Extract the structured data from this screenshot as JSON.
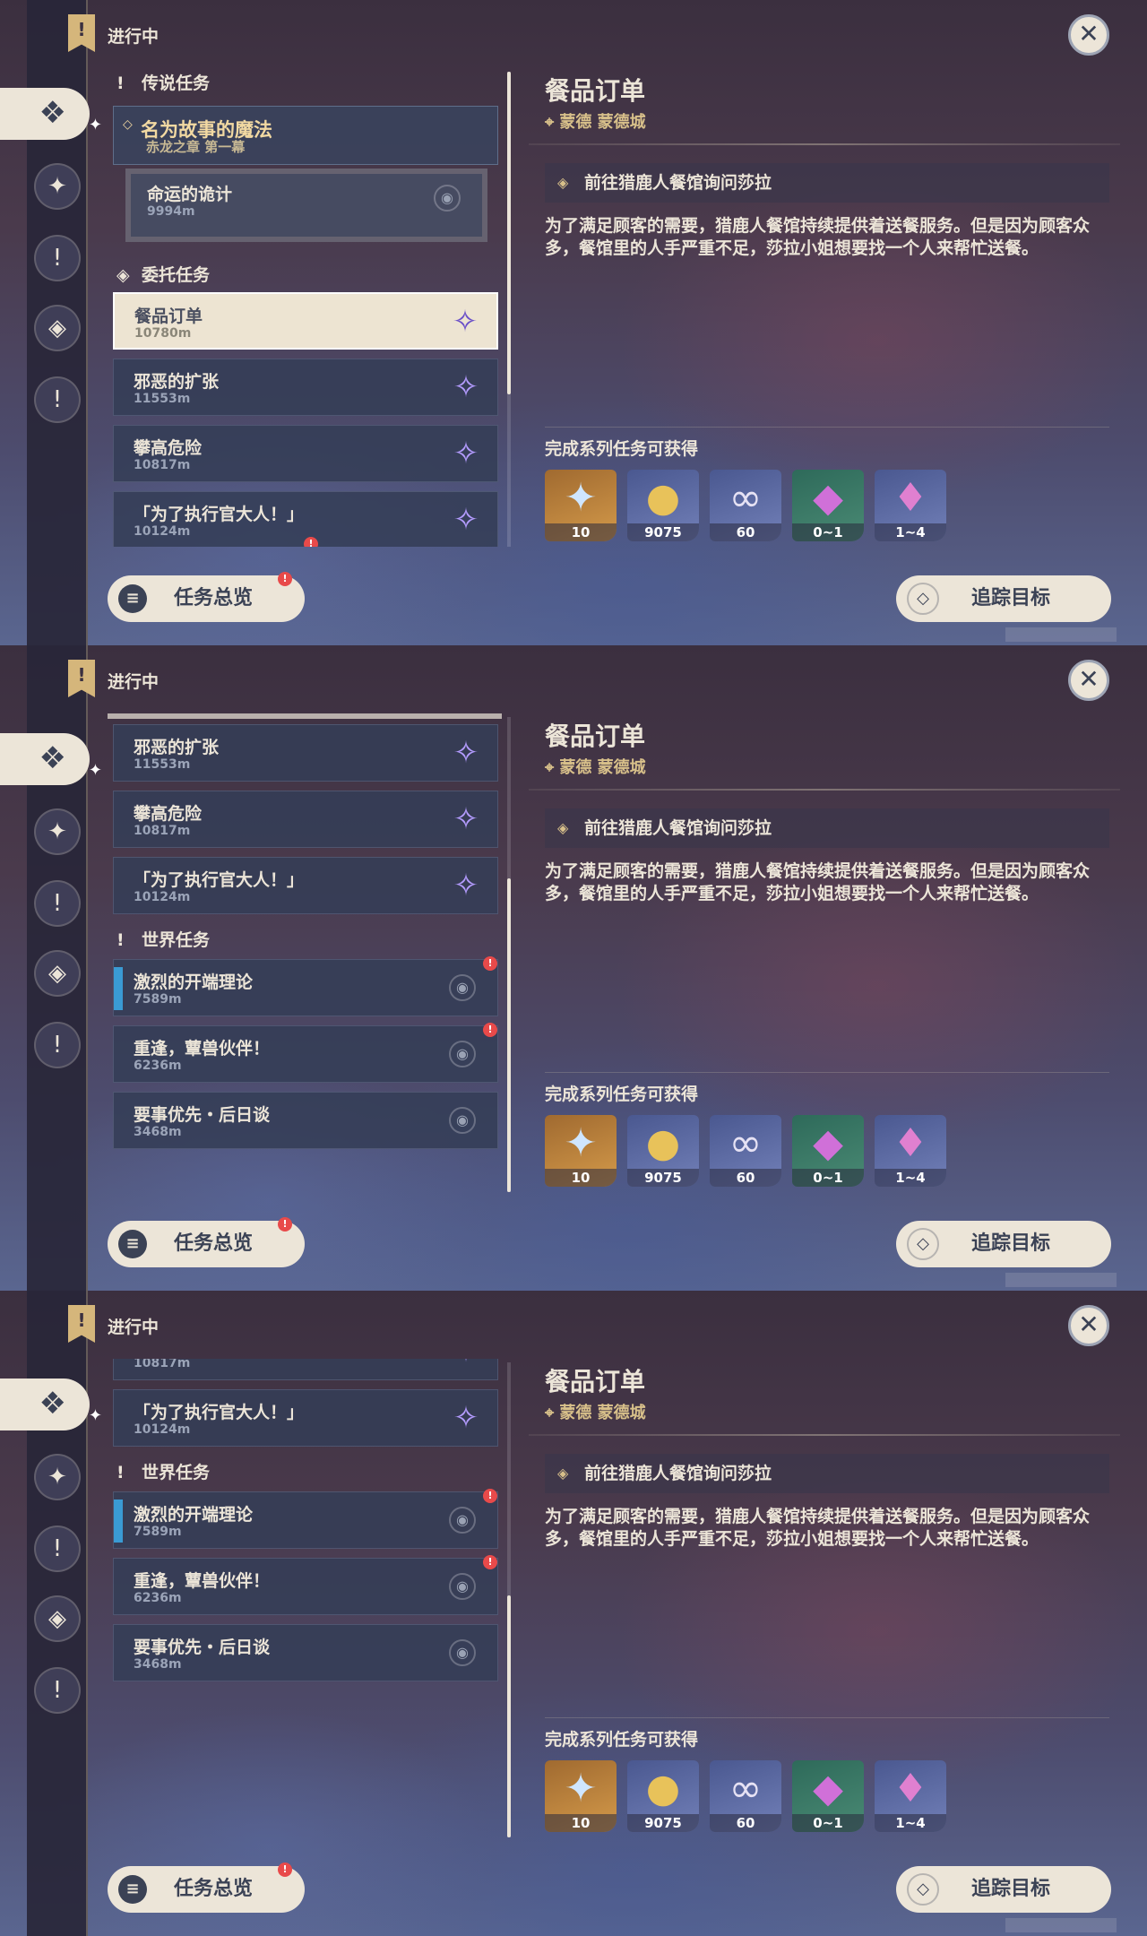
{
  "status_label": "进行中",
  "categories": {
    "legend": "传说任务",
    "commission": "委托任务",
    "world": "世界任务"
  },
  "legend_quest": {
    "title": "名为故事的魔法",
    "subtitle": "赤龙之章 第一幕"
  },
  "legend_subquest": {
    "title": "命运的诡计",
    "distance": "9994m"
  },
  "commissions": [
    {
      "title": "餐品订单",
      "distance": "10780m"
    },
    {
      "title": "邪恶的扩张",
      "distance": "11553m"
    },
    {
      "title": "攀高危险",
      "distance": "10817m"
    },
    {
      "title": "「为了执行官大人！」",
      "distance": "10124m"
    }
  ],
  "world_quests": [
    {
      "title": "激烈的开端理论",
      "distance": "7589m"
    },
    {
      "title": "重逢，蕈兽伙伴！",
      "distance": "6236m"
    },
    {
      "title": "要事优先・后日谈",
      "distance": "3468m"
    }
  ],
  "detail": {
    "title": "餐品订单",
    "location": "蒙德 蒙德城",
    "objective": "前往猎鹿人餐馆询问莎拉",
    "description": "为了满足顾客的需要，猎鹿人餐馆持续提供着送餐服务。但是因为顾客众多，餐馆里的人手严重不足，莎拉小姐想要找一个人来帮忙送餐。",
    "rewards_label": "完成系列任务可获得",
    "rewards": [
      {
        "icon": "primogem-icon",
        "count": "10",
        "bg": "orange"
      },
      {
        "icon": "mora-icon",
        "count": "9075",
        "bg": "blue"
      },
      {
        "icon": "fetters-icon",
        "count": "60",
        "bg": "blue"
      },
      {
        "icon": "crystal-chunk-icon",
        "count": "0~1",
        "bg": "green"
      },
      {
        "icon": "crystal-cluster-icon",
        "count": "1~4",
        "bg": "blue"
      }
    ]
  },
  "buttons": {
    "overview": "任务总览",
    "track": "追踪目标"
  },
  "colors": {
    "accent_gold": "#d8c08a",
    "card_bg": "#343e56",
    "selected_bg": "#ede4d2",
    "alert_red": "#e84a4a",
    "track_blue": "#3a9bd4"
  }
}
